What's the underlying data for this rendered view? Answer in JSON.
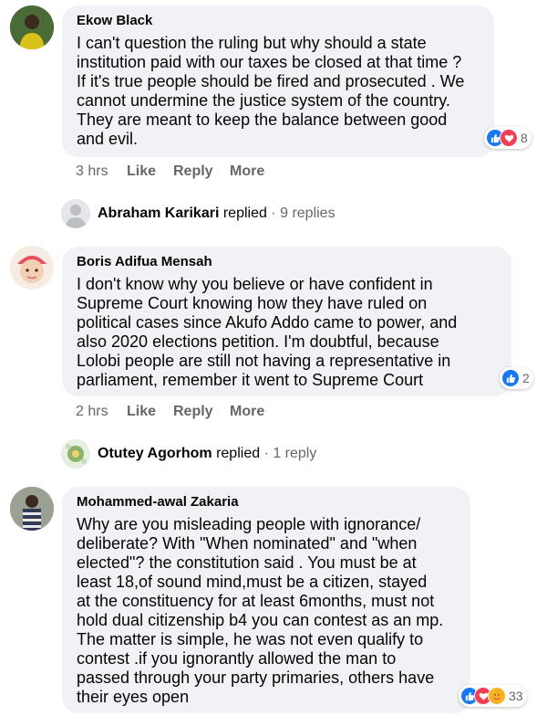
{
  "comments": [
    {
      "author": "Ekow Black",
      "text": "I can't question the ruling but why should a state\ninstitution paid with our taxes be closed at that time ?\nIf it's true people should be fired and prosecuted . We\ncannot undermine the justice system of the country.\nThey are meant to keep the balance between good\nand evil.",
      "time": "3 hrs",
      "reaction_icons": [
        "like-icon",
        "love-icon"
      ],
      "reaction_count": "8"
    },
    {
      "author": "Boris Adifua Mensah",
      "text": "I don't know why you believe or have confident in\nSupreme Court knowing how they have ruled on\npolitical cases since Akufo Addo came to power, and\nalso 2020 elections petition. I'm doubtful, because\nLolobi people are still not having a representative in\nparliament, remember it went to Supreme Court",
      "time": "2 hrs",
      "reaction_icons": [
        "like-icon"
      ],
      "reaction_count": "2"
    },
    {
      "author": "Mohammed-awal Zakaria",
      "text": "Why are you misleading people with ignorance/\ndeliberate? With \"When nominated\" and \"when\nelected\"? the constitution said . You must be at\nleast 18,of sound mind,must be a citizen, stayed\nat the constituency for at least 6months, must not\nhold dual citizenship b4 you can contest as an mp.\nThe matter is simple, he was not even qualify to\ncontest .if you ignorantly allowed the man to\npassed through your party primaries, others have\ntheir eyes open",
      "reaction_icons": [
        "like-icon",
        "love-icon",
        "care-icon"
      ],
      "reaction_count": "33"
    }
  ],
  "actions": {
    "like": "Like",
    "reply": "Reply",
    "more": "More"
  },
  "replies": [
    {
      "name": "Abraham Karikari",
      "verb": "replied",
      "count": "· 9 replies"
    },
    {
      "name": "Otutey Agorhom",
      "verb": "replied",
      "count": "· 1 reply"
    }
  ],
  "colors": {
    "bubble": "#f0f2f5",
    "like": "#1877f2",
    "love": "#f33e58",
    "care": "#f7b125",
    "meta": "#65676b"
  }
}
